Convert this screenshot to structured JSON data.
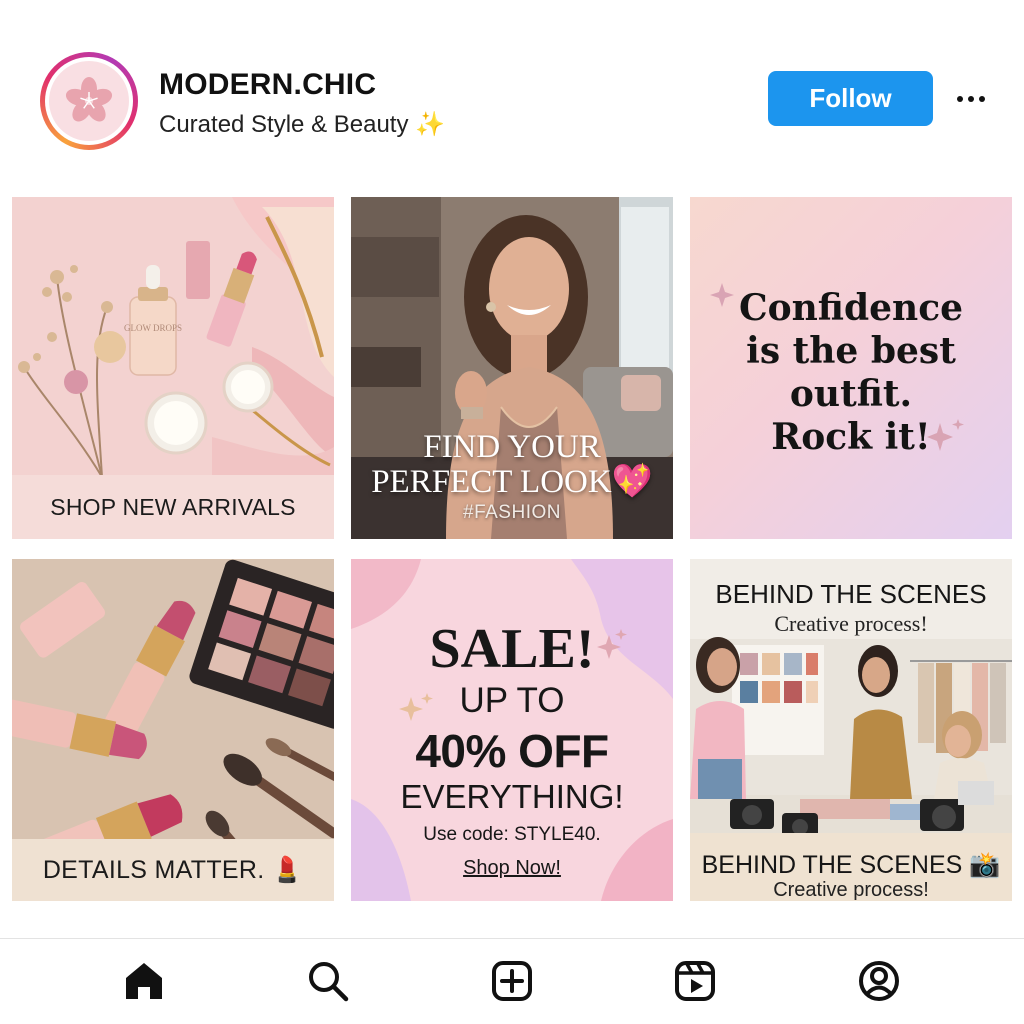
{
  "profile": {
    "username": "MODERN.CHIC",
    "bio": "Curated Style & Beauty",
    "bio_emoji": "✨",
    "avatar_icon": "cherry-blossom-icon",
    "follow_label": "Follow",
    "more_icon": "more-dots-icon"
  },
  "posts": [
    {
      "caption": "SHOP NEW ARRIVALS",
      "product_label": "GLOW DROPS"
    },
    {
      "headline_1": "FIND YOUR",
      "headline_2": "PERFECT LOOK",
      "headline_emoji": "💖",
      "hashtag": "#FASHION"
    },
    {
      "quote_lines": [
        "Confidence",
        "is the best",
        "outfit.",
        "Rock it!"
      ]
    },
    {
      "caption": "DETAILS MATTER.",
      "caption_emoji": "💄"
    },
    {
      "headline": "SALE!",
      "line_2": "UP TO",
      "line_3": "40% OFF",
      "line_4": "EVERYTHING!",
      "code_text": "Use code: STYLE40.",
      "cta": "Shop Now!"
    },
    {
      "top_title": "BEHIND THE SCENES",
      "top_subtitle": "Creative process!",
      "bottom_title": "BEHIND THE SCENES",
      "bottom_title_emoji": "📸",
      "bottom_subtitle": "Creative process!"
    }
  ],
  "nav": [
    {
      "name": "home",
      "icon": "home-icon",
      "active": true
    },
    {
      "name": "search",
      "icon": "search-icon"
    },
    {
      "name": "create",
      "icon": "add-square-icon"
    },
    {
      "name": "reels",
      "icon": "reels-icon"
    },
    {
      "name": "profile",
      "icon": "profile-icon"
    }
  ],
  "colors": {
    "follow_button": "#1c95ee",
    "accent_pink": "#e58fa3",
    "text_dark": "#111111"
  }
}
